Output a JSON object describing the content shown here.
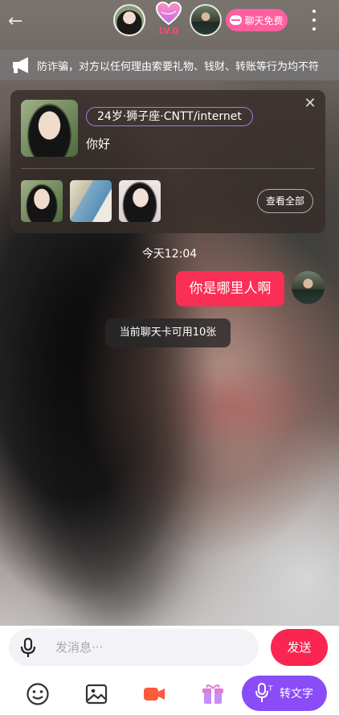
{
  "header": {
    "level_label": "LV.0",
    "chat_free_label": "聊天免费"
  },
  "warning": {
    "text": "防诈骗，对方以任何理由索要礼物、钱财、转账等行为均不符"
  },
  "profile_card": {
    "tagline": "24岁·狮子座·CNTT/internet",
    "greeting": "你好",
    "view_all_label": "查看全部",
    "photo_count": 3
  },
  "conversation": {
    "timestamp": "今天12:04",
    "outgoing_message": "你是哪里人啊",
    "system_note": "当前聊天卡可用10张"
  },
  "composer": {
    "placeholder": "发消息···",
    "send_label": "发送",
    "convert_label": "转文字"
  },
  "colors": {
    "accent_red": "#fb2552",
    "chat_bubble": "#f92f55",
    "chat_free_pink": "#ff5f9e",
    "convert_purple": "#8a4cf6",
    "level_text": "#ff4a6b"
  },
  "icons": [
    "back-arrow-icon",
    "heart-level-icon",
    "chat-bubble-icon",
    "more-vertical-icon",
    "speaker-icon",
    "close-icon",
    "microphone-icon",
    "emoji-icon",
    "image-icon",
    "video-call-icon",
    "gift-icon",
    "voice-to-text-icon"
  ]
}
